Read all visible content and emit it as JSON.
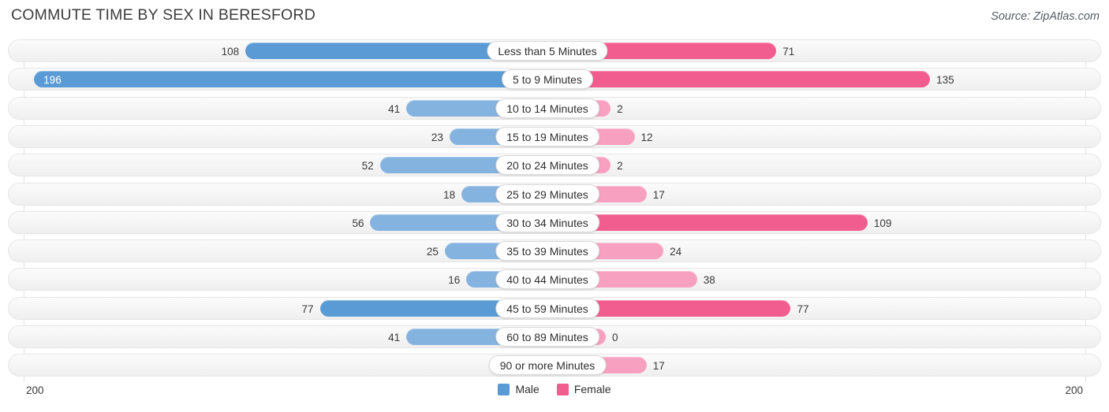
{
  "header": {
    "title": "COMMUTE TIME BY SEX IN BERESFORD",
    "source": "Source: ZipAtlas.com"
  },
  "axis": {
    "left_label": "200",
    "right_label": "200",
    "max": 200
  },
  "legend": [
    {
      "label": "Male",
      "color": "#5b9bd5"
    },
    {
      "label": "Female",
      "color": "#f15d8e"
    }
  ],
  "colors": {
    "male_strong": "#5b9bd5",
    "male_light": "#85b3e0",
    "female_strong": "#f15d8e",
    "female_light": "#f8a0c0",
    "row_background": "#f6f6f6",
    "gridline": "#e2e2e2"
  },
  "chart_data": {
    "type": "bar",
    "orientation": "horizontal-diverging",
    "title": "COMMUTE TIME BY SEX IN BERESFORD",
    "subtitle": "Source: ZipAtlas.com",
    "xlabel": "",
    "ylabel": "",
    "xlim": [
      200,
      200
    ],
    "grid": true,
    "legend_position": "bottom-center",
    "categories": [
      "Less than 5 Minutes",
      "5 to 9 Minutes",
      "10 to 14 Minutes",
      "15 to 19 Minutes",
      "20 to 24 Minutes",
      "25 to 29 Minutes",
      "30 to 34 Minutes",
      "35 to 39 Minutes",
      "40 to 44 Minutes",
      "45 to 59 Minutes",
      "60 to 89 Minutes",
      "90 or more Minutes"
    ],
    "series": [
      {
        "name": "Male",
        "values": [
          108,
          196,
          41,
          23,
          52,
          18,
          56,
          25,
          16,
          77,
          41,
          0
        ]
      },
      {
        "name": "Female",
        "values": [
          71,
          135,
          2,
          12,
          2,
          17,
          109,
          24,
          38,
          77,
          0,
          17
        ]
      }
    ]
  },
  "rows": [
    {
      "label": "Less than 5 Minutes",
      "male": "108",
      "female": "71",
      "male_v": 108,
      "female_v": 71
    },
    {
      "label": "5 to 9 Minutes",
      "male": "196",
      "female": "135",
      "male_v": 196,
      "female_v": 135
    },
    {
      "label": "10 to 14 Minutes",
      "male": "41",
      "female": "2",
      "male_v": 41,
      "female_v": 2
    },
    {
      "label": "15 to 19 Minutes",
      "male": "23",
      "female": "12",
      "male_v": 23,
      "female_v": 12
    },
    {
      "label": "20 to 24 Minutes",
      "male": "52",
      "female": "2",
      "male_v": 52,
      "female_v": 2
    },
    {
      "label": "25 to 29 Minutes",
      "male": "18",
      "female": "17",
      "male_v": 18,
      "female_v": 17
    },
    {
      "label": "30 to 34 Minutes",
      "male": "56",
      "female": "109",
      "male_v": 56,
      "female_v": 109
    },
    {
      "label": "35 to 39 Minutes",
      "male": "25",
      "female": "24",
      "male_v": 25,
      "female_v": 24
    },
    {
      "label": "40 to 44 Minutes",
      "male": "16",
      "female": "38",
      "male_v": 16,
      "female_v": 38
    },
    {
      "label": "45 to 59 Minutes",
      "male": "77",
      "female": "77",
      "male_v": 77,
      "female_v": 77
    },
    {
      "label": "60 to 89 Minutes",
      "male": "41",
      "female": "0",
      "male_v": 41,
      "female_v": 0
    },
    {
      "label": "90 or more Minutes",
      "male": "0",
      "female": "17",
      "male_v": 0,
      "female_v": 17
    }
  ]
}
